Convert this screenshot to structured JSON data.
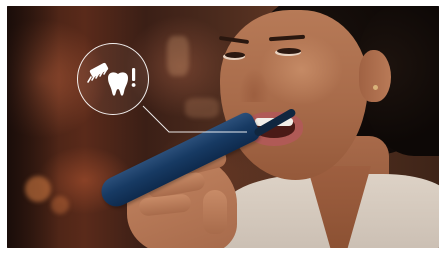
{
  "scene": {
    "subject": "woman-brushing-teeth",
    "toothbrush_color": "#173a63",
    "shirt_color": "#d6cabe"
  },
  "callout": {
    "icon_names": [
      "brush-head-icon",
      "tooth-icon",
      "exclamation-icon"
    ],
    "ring_color": "#ffffff"
  }
}
